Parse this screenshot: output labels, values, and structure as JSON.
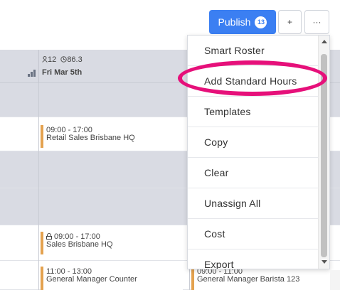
{
  "toolbar": {
    "publish_label": "Publish",
    "publish_count": "13",
    "add_label": "+",
    "more_label": "···"
  },
  "header": {
    "staff_count": "12",
    "hours_value": "86.3",
    "day": "Fri Mar 5th"
  },
  "shifts": [
    {
      "time": "09:00 - 17:00",
      "location": "Retail Sales Brisbane HQ",
      "locked": false
    },
    {
      "time": "09:00 - 17:00",
      "location": "Sales Brisbane HQ",
      "locked": true
    },
    {
      "time": "11:00 - 13:00",
      "location": "General Manager Counter",
      "locked": false
    },
    {
      "time": "09:00 - 11:00",
      "location": "General Manager Barista 123",
      "locked": false
    }
  ],
  "menu": {
    "items": [
      "Smart Roster",
      "Add Standard Hours",
      "Templates",
      "Copy",
      "Clear",
      "Unassign All",
      "Cost",
      "Export"
    ]
  },
  "icons": {
    "staff": "person-icon",
    "hours": "clock-icon",
    "stats": "bar-chart-icon",
    "lock": "lock-icon"
  },
  "colors": {
    "publish_blue": "#3b7ff2",
    "shift_accent": "#e4a24f",
    "highlight": "#e6107a",
    "header_grey": "#d9dbe3"
  }
}
